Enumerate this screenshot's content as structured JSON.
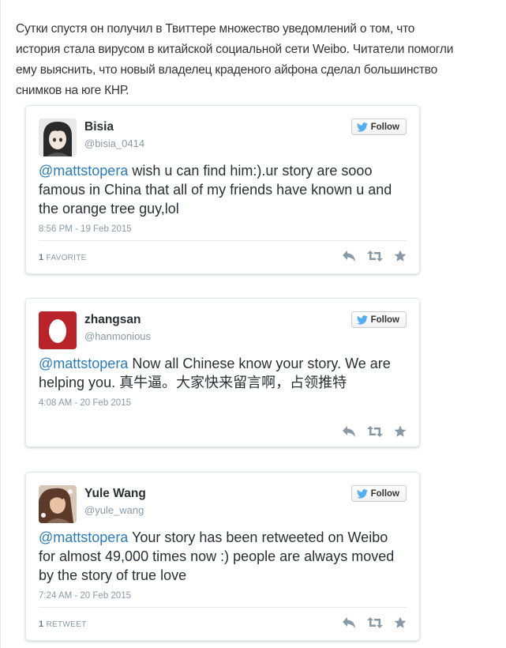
{
  "intro_text": "Сутки спустя он получил в Твиттере множество уведомлений о том, что история стала вирусом в китайской социальной сети Weibo. Читатели помогли ему выяснить, что новый владелец краденого айфона сделал большинство снимков на юге КНР.",
  "colors": {
    "link": "#2b7bb9",
    "meta": "#8899a6",
    "twitter_bird": "#55acee",
    "egg_bg": "#b8242a"
  },
  "tweets": [
    {
      "name": "Bisia",
      "handle": "@bisia_0414",
      "follow_label": "Follow",
      "mention": "@mattstopera",
      "text": " wish u can find him:).ur story are sooo famous in China that all of my friends have known u and the orange tree guy,lol",
      "timestamp": "8:56 PM - 19 Feb 2015",
      "stat_count": "1",
      "stat_label": "FAVORITE",
      "avatar_icon": "anime-girl-avatar"
    },
    {
      "name": "zhangsan",
      "handle": "@hanmonious",
      "follow_label": "Follow",
      "mention": "@mattstopera",
      "text": " Now all Chinese know your story. We are helping you. 真牛逼。大家快来留言啊，占领推特",
      "timestamp": "4:08 AM - 20 Feb 2015",
      "stat_count": "",
      "stat_label": "",
      "avatar_icon": "default-egg-avatar"
    },
    {
      "name": "Yule Wang",
      "handle": "@yule_wang",
      "follow_label": "Follow",
      "mention": "@mattstopera",
      "text": " Your story has been retweeted on Weibo for almost 49,000 times now :) people are always moved by the story of true love",
      "timestamp": "7:24 AM - 20 Feb 2015",
      "stat_count": "1",
      "stat_label": "RETWEET",
      "avatar_icon": "photo-avatar"
    }
  ]
}
